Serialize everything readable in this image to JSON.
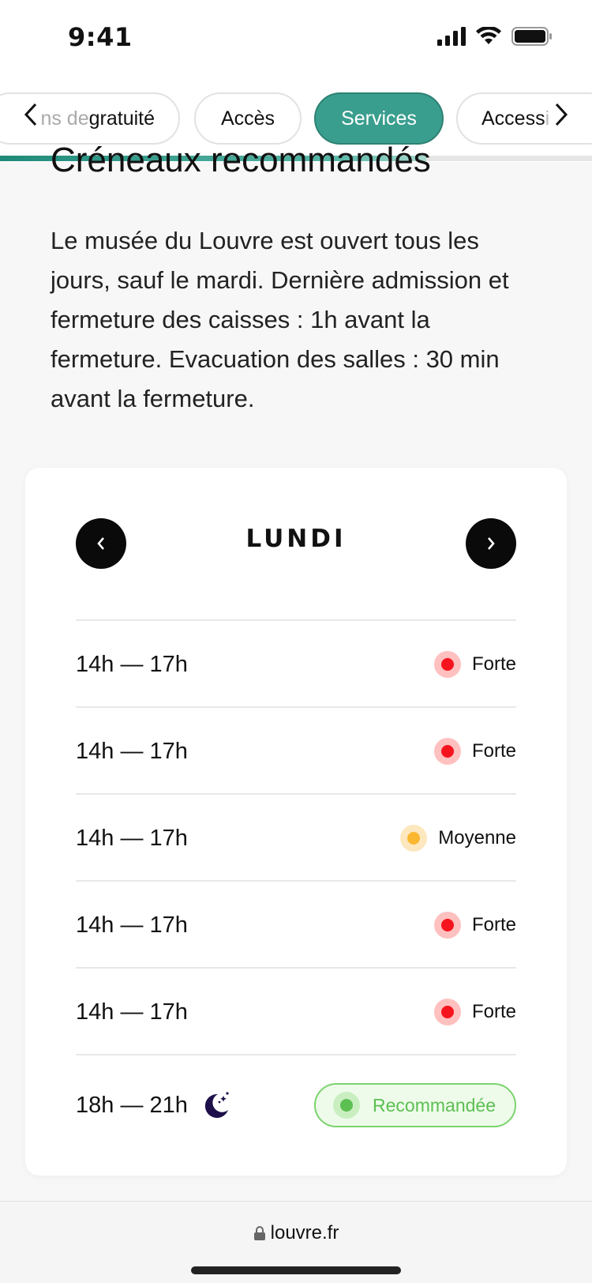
{
  "status_bar": {
    "time": "9:41"
  },
  "tabs": {
    "items": [
      {
        "label_faded": "ns de",
        "label": " gratuité",
        "active": false
      },
      {
        "label": "Accès",
        "active": false
      },
      {
        "label": "Services",
        "active": true
      },
      {
        "label": "Access",
        "label_faded": "i",
        "active": false
      }
    ],
    "scroll_progress": 0.72
  },
  "section": {
    "title": "Créneaux recommandés",
    "intro": "Le musée du Louvre est ouvert tous les jours, sauf le mardi. Dernière admission et fermeture des caisses : 1h avant la fermeture. Evacuation des salles : 30 min avant la fermeture."
  },
  "schedule": {
    "day": "LUNDI",
    "slots": [
      {
        "time": "14h — 17h",
        "status": "Forte"
      },
      {
        "time": "14h — 17h",
        "status": "Forte"
      },
      {
        "time": "14h — 17h",
        "status": "Moyenne"
      },
      {
        "time": "14h — 17h",
        "status": "Forte"
      },
      {
        "time": "14h — 17h",
        "status": "Forte"
      },
      {
        "time": "18h — 21h",
        "status": "Recommandée",
        "night_icon": "moon-stars-icon"
      }
    ]
  },
  "colors": {
    "accent": "#3a9e8e",
    "forte": "#f5141e",
    "forte_halo": "#ffc0c0",
    "moyenne": "#fbb72f",
    "moyenne_halo": "#fde7bf",
    "recommandee": "#5cbf52"
  },
  "browser": {
    "url": "louvre.fr"
  }
}
